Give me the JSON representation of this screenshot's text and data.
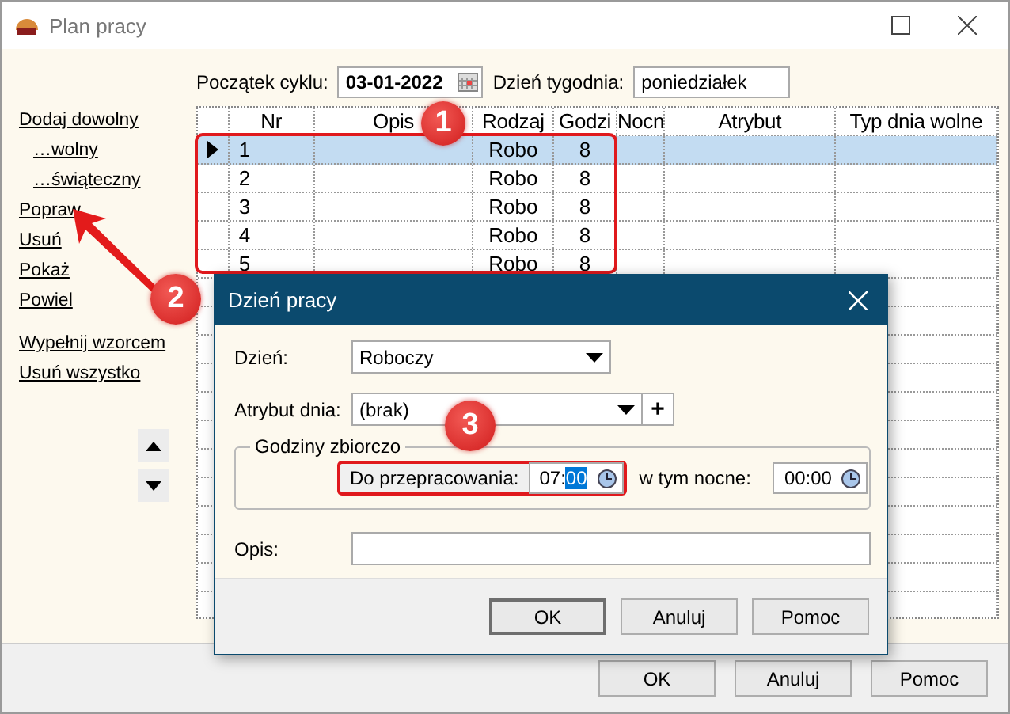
{
  "window": {
    "title": "Plan pracy"
  },
  "cycle_start": {
    "label": "Początek cyklu:",
    "value": "03-01-2022"
  },
  "weekday": {
    "label": "Dzień tygodnia:",
    "value": "poniedziałek"
  },
  "sidebar": {
    "links": [
      {
        "label": "Dodaj dowolny",
        "children": [
          {
            "label": "…wolny"
          },
          {
            "label": "…świąteczny"
          }
        ]
      },
      {
        "label": "Popraw"
      },
      {
        "label": "Usuń"
      },
      {
        "label": "Pokaż"
      },
      {
        "label": "Powiel"
      },
      {
        "label": "Wypełnij wzorcem"
      },
      {
        "label": "Usuń wszystko"
      }
    ]
  },
  "table": {
    "columns": [
      "Nr",
      "Opis",
      "Rodzaj",
      "Godzi",
      "Nocn",
      "Atrybut",
      "Typ dnia wolne"
    ],
    "rows": [
      {
        "nr": "1",
        "rodzaj": "Robo",
        "godziny": "8",
        "selected": true
      },
      {
        "nr": "2",
        "rodzaj": "Robo",
        "godziny": "8",
        "selected": false
      },
      {
        "nr": "3",
        "rodzaj": "Robo",
        "godziny": "8",
        "selected": false
      },
      {
        "nr": "4",
        "rodzaj": "Robo",
        "godziny": "8",
        "selected": false
      },
      {
        "nr": "5",
        "rodzaj": "Robo",
        "godziny": "8",
        "selected": false
      }
    ]
  },
  "buttons": [
    "OK",
    "Anuluj",
    "Pomoc"
  ],
  "dialog": {
    "title": "Dzień pracy",
    "day": {
      "label": "Dzień:",
      "value": "Roboczy"
    },
    "attribute": {
      "label": "Atrybut dnia:",
      "value": "(brak)",
      "add": "+"
    },
    "group": {
      "legend": "Godziny zbiorczo",
      "work": {
        "label": "Do przepracowania:",
        "value": "07:00",
        "minutes_selected": true
      },
      "night": {
        "label": "w tym nocne:",
        "value": "00:00",
        "minutes_selected": false
      }
    },
    "description": {
      "label": "Opis:"
    },
    "buttons": [
      "OK",
      "Anuluj",
      "Pomoc"
    ]
  },
  "callouts": [
    "1",
    "2",
    "3"
  ]
}
